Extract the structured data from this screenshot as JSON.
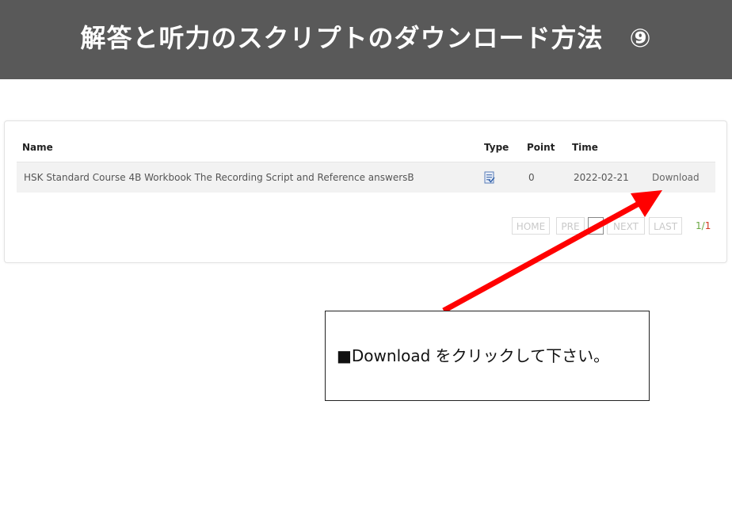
{
  "header": {
    "title": "解答と听力のスクリプトのダウンロード方法　⑨",
    "background": "#595959"
  },
  "table": {
    "columns": {
      "name": "Name",
      "type": "Type",
      "point": "Point",
      "time": "Time"
    },
    "rows": [
      {
        "name": "HSK Standard Course 4B Workbook The Recording Script and Reference answersB",
        "type_icon": "document-icon",
        "point": "0",
        "time": "2022-02-21",
        "action": "Download"
      }
    ]
  },
  "pagination": {
    "home": "HOME",
    "prev": "PRE",
    "next": "NEXT",
    "last": "LAST",
    "current": "1",
    "separator": "/",
    "total": "1"
  },
  "callout": {
    "text": "■Download をクリックして下さい。"
  },
  "colors": {
    "arrow": "#ff0000",
    "page_current": "#6aa843",
    "page_total": "#d13b20"
  }
}
